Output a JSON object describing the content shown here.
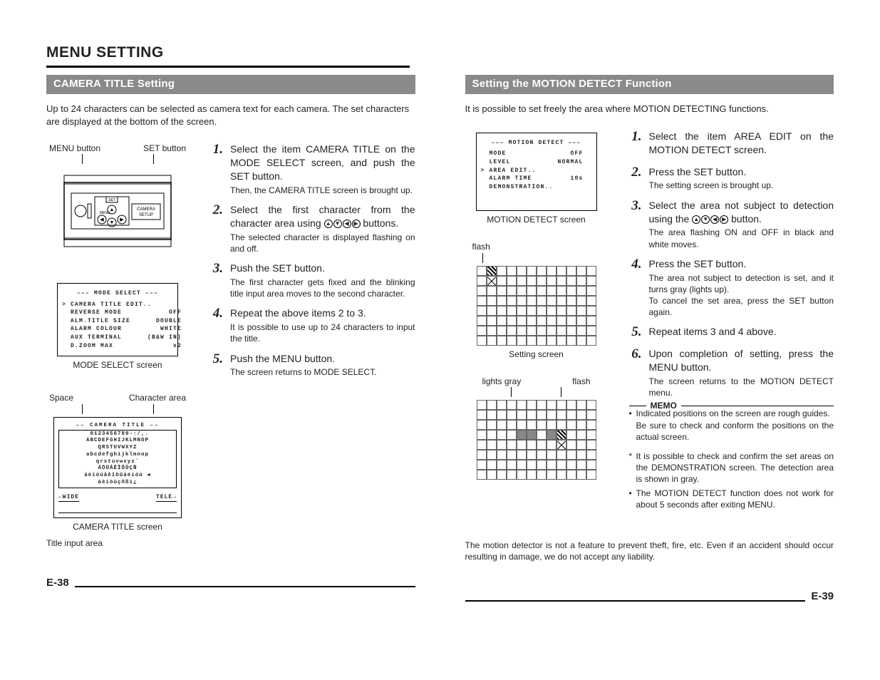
{
  "page_title": "MENU SETTING",
  "left": {
    "section_title": "CAMERA TITLE Setting",
    "intro": "Up to 24 characters can be selected as camera text for each camera. The set characters are displayed at the bottom of the screen.",
    "labels": {
      "menu_button": "MENU button",
      "set_button": "SET button",
      "mode_select_caption": "MODE SELECT screen",
      "space": "Space",
      "char_area": "Character area",
      "camera_title_caption": "CAMERA TITLE screen",
      "title_input": "Title input area"
    },
    "mode_select_screen": {
      "header": "––– MODE SELECT –––",
      "rows": [
        [
          "> CAMERA TITLE EDIT..",
          ""
        ],
        [
          "  REVERSE MODE",
          "OFF"
        ],
        [
          "  ALM.TITLE SIZE",
          "DOUBLE"
        ],
        [
          "  ALARM COLOUR",
          "WHITE"
        ],
        [
          "  AUX TERMINAL",
          "(B&W IN)"
        ],
        [
          "  D.ZOOM MAX",
          "x2"
        ]
      ]
    },
    "camera_title_screen": {
      "header": "––  CAMERA TITLE  ––",
      "lines": [
        " 0123456789-:/,.",
        "ABCDEFGHIJKLMNOP",
        "QRSTUVWXYZ",
        "abcdefghijklmnop",
        "qrstuvwxyz¨",
        "ÄÖÜÂÊÎÔÛÇÑ",
        "äëïöüâêîôûáéíóù ◀",
        "àèìòùçñßì¿"
      ],
      "nav_left": "←WIDE",
      "nav_right": "TELE→"
    },
    "steps": [
      {
        "n": "1.",
        "main": "Select the item CAMERA TITLE on the MODE SELECT screen, and push the SET button.",
        "sub": "Then, the CAMERA TITLE screen is brought up."
      },
      {
        "n": "2.",
        "main": "Select the first character from the character area using ​ buttons.",
        "sub": "The selected character is displayed flashing on and off.",
        "icons": true
      },
      {
        "n": "3.",
        "main": "Push the SET button.",
        "sub": "The first character gets fixed and the blinking title input area moves to the second character."
      },
      {
        "n": "4.",
        "main": "Repeat the above items 2 to 3.",
        "sub": "It is possible to use up to 24 characters to input the title."
      },
      {
        "n": "5.",
        "main": "Push the MENU button.",
        "sub": "The screen returns to MODE SELECT."
      }
    ],
    "page_no": "E-38"
  },
  "right": {
    "section_title": "Setting the MOTION DETECT Function",
    "intro": "It is possible to set freely the area where MOTION DETECTING functions.",
    "motion_screen": {
      "header": "––– MOTION DETECT –––",
      "rows": [
        [
          "  MODE",
          "OFF"
        ],
        [
          "  LEVEL",
          "NORMAL"
        ],
        [
          "> AREA EDIT..",
          ""
        ],
        [
          "  ALARM TIME",
          "10s"
        ],
        [
          "  DEMONSTRATION..",
          ""
        ]
      ],
      "caption": "MOTION DETECT screen"
    },
    "setting_screen_label": "flash",
    "setting_screen_caption": "Setting screen",
    "grid2_labels": {
      "gray": "lights gray",
      "flash": "flash"
    },
    "steps": [
      {
        "n": "1.",
        "main": "Select the item AREA EDIT on the MOTION DETECT screen.",
        "sub": ""
      },
      {
        "n": "2.",
        "main": "Press the SET button.",
        "sub": "The setting screen is brought up."
      },
      {
        "n": "3.",
        "main": "Select the area not subject to detection using the ​ button.",
        "sub": "The area flashing ON and OFF in black and white moves.",
        "icons": true
      },
      {
        "n": "4.",
        "main": "Press the SET button.",
        "sub": "The area not subject to detection is set, and it turns gray (lights up).\nTo cancel the set area, press the SET button again."
      },
      {
        "n": "5.",
        "main": "Repeat items 3 and 4 above.",
        "sub": ""
      },
      {
        "n": "6.",
        "main": "Upon completion of setting, press the MENU button.",
        "sub": "The screen returns to the MOTION DETECT menu."
      }
    ],
    "memo": {
      "title": "MEMO",
      "items": [
        "Indicated positions on the screen are rough guides.\nBe sure to check and conform the positions on the actual screen."
      ],
      "star_items": [
        "It is possible to check and confirm the set areas on the DEMONSTRATION screen. The detection area is shown in gray.",
        "The MOTION DETECT function does not work for about 5 seconds after exiting MENU."
      ]
    },
    "disclaimer": "The motion detector is not a feature to prevent theft, fire, etc.  Even if an accident should occur resulting in damage, we do not accept any liability.",
    "page_no": "E-39"
  }
}
